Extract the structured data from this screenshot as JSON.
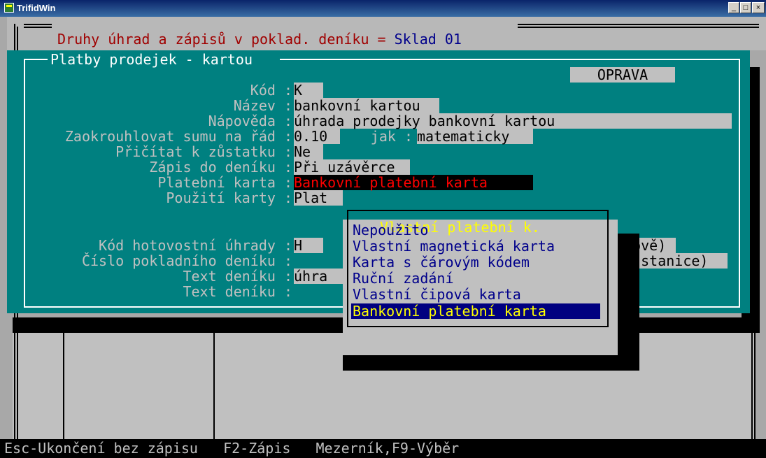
{
  "window": {
    "title": "TrifidWin",
    "min_label": "_",
    "max_label": "□",
    "close_label": "×"
  },
  "outer_dialog": {
    "title_part1": "Druhy úhrad a zápisů v poklad. deníku = ",
    "title_part2": "Sklad 01"
  },
  "panel": {
    "title": "Platby prodejek - kartou",
    "mode": "OPRAVA"
  },
  "fields": {
    "kod": {
      "label": "Kód :",
      "value": "K"
    },
    "nazev": {
      "label": "Název :",
      "value": "bankovní kartou"
    },
    "napoveda": {
      "label": "Nápověda :",
      "value": "úhrada prodejky bankovní kartou"
    },
    "zaokrouhlovat": {
      "label": "Zaokrouhlovat sumu na řád :",
      "value": "0.10",
      "jak_label": "jak :",
      "jak_value": "matematicky"
    },
    "pricitat": {
      "label": "Přičítat k zůstatku :",
      "value": "Ne"
    },
    "zapis": {
      "label": "Zápis do deníku :",
      "value": "Při uzávěrce"
    },
    "platebni_karta": {
      "label": "Platební karta :",
      "value": "Bankovní platební karta"
    },
    "pouziti_karty": {
      "label": "Použití karty :",
      "value": "Plat"
    },
    "kod_hotovostni": {
      "label": "Kód hotovostní úhrady :",
      "value": "H",
      "suffix": "otově)"
    },
    "cislo_pokladniho": {
      "label": "Číslo pokladního deníku :",
      "value": "",
      "suffix": "né stanice)"
    },
    "text_deniku_1": {
      "label": "Text deníku :",
      "value": "úhra"
    },
    "text_deniku_2": {
      "label": "Text deníku :",
      "value": ""
    }
  },
  "popup": {
    "title": "Vlastní platební k.",
    "options": [
      "Nepoužito",
      "Vlastní magnetická karta",
      "Karta s čárovým kódem",
      "Ruční zadání",
      "Vlastní čipová karta",
      "Bankovní platební karta"
    ],
    "selected_index": 5
  },
  "statusbar": {
    "text": "Esc-Ukončení bez zápisu   F2-Zápis   Mezerník,F9-Výběr"
  },
  "colors": {
    "panel": "#008080",
    "field": "#c0c0c0",
    "popup_title": "#ffff00",
    "selected_option_bg": "#000080",
    "alert_text": "#ff0000"
  }
}
